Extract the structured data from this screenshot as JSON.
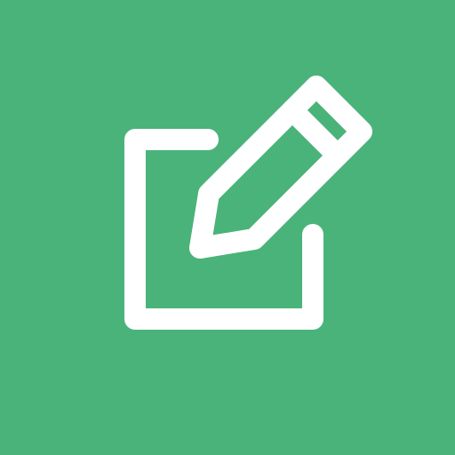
{
  "icon": {
    "name": "edit-icon",
    "background_color": "#4AB37A",
    "glyph_color": "#FFFFFF",
    "glyph": "pencil-on-square"
  }
}
